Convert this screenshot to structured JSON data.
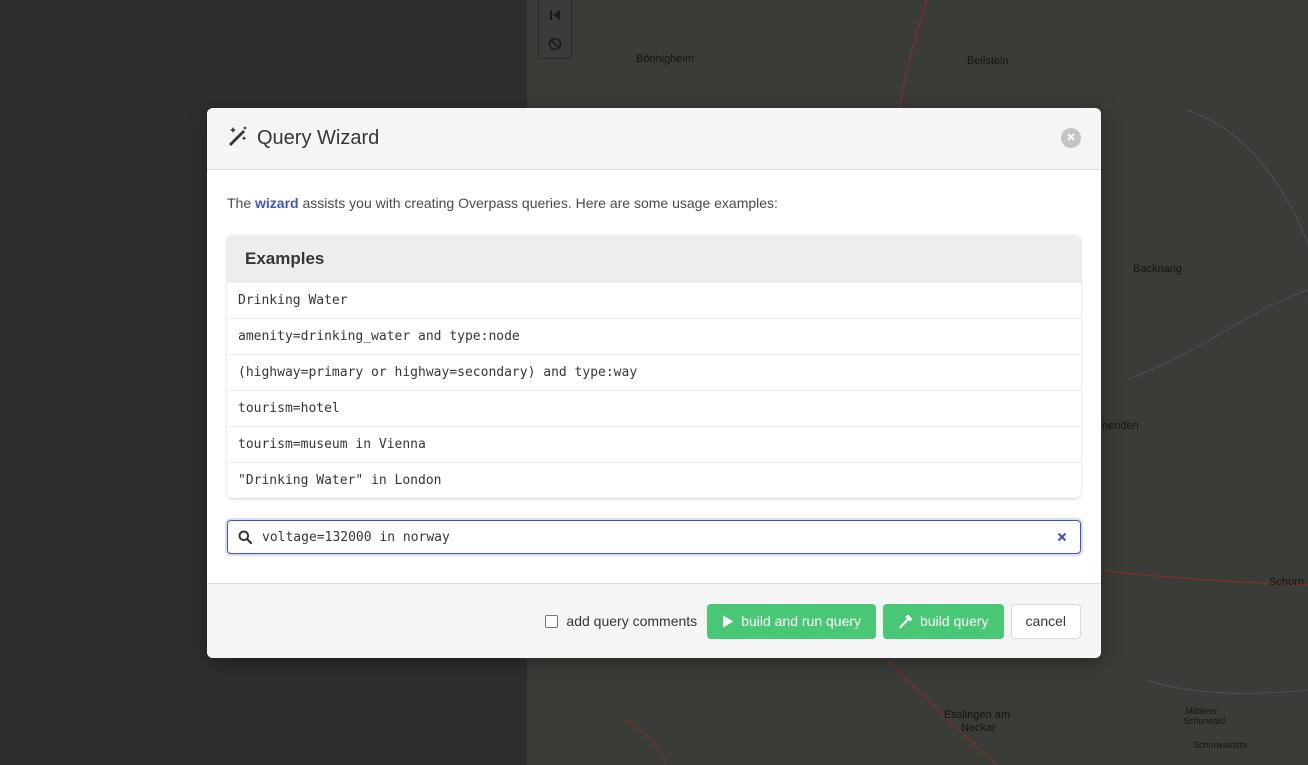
{
  "map": {
    "labels": [
      "Bönnigheim",
      "Beilstein",
      "Backnang",
      "nenden",
      "Schorn",
      "Esslingen am",
      "Neckar",
      "Mittlerer",
      "Schurwald",
      "Schurwaldsta"
    ]
  },
  "modal": {
    "title": "Query Wizard",
    "icon": "magic-wand-icon",
    "intro_before": "The ",
    "intro_link": "wizard",
    "intro_after": " assists you with creating Overpass queries. Here are some usage examples:",
    "examples_heading": "Examples",
    "examples": [
      "Drinking Water",
      "amenity=drinking_water and type:node",
      "(highway=primary or highway=secondary) and type:way",
      "tourism=hotel",
      "tourism=museum in Vienna",
      "\"Drinking Water\" in London"
    ],
    "search_value": "voltage=132000 in norway",
    "checkbox_label": "add query comments",
    "build_run_label": "build and run query",
    "build_label": "build query",
    "cancel_label": "cancel"
  },
  "colors": {
    "accent": "#3e56c4",
    "success": "#48c774"
  }
}
